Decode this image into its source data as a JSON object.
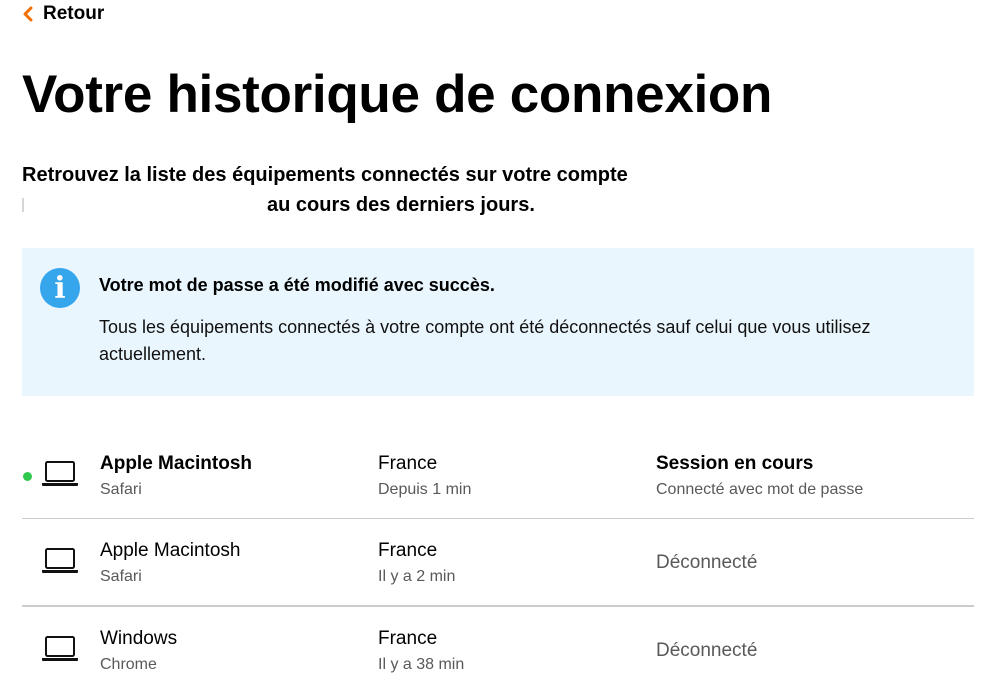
{
  "nav": {
    "back_label": "Retour"
  },
  "page": {
    "title": "Votre historique de connexion",
    "intro_line1": "Retrouvez la liste des équipements connectés sur votre compte",
    "intro_line2": "au cours des derniers jours."
  },
  "info": {
    "icon": "info-icon",
    "heading": "Votre mot de passe a été modifié avec succès.",
    "body": "Tous les équipements connectés à votre compte ont été déconnectés sauf celui que vous utilisez actuellement."
  },
  "colors": {
    "accent": "#f16e00",
    "info_bg": "#e9f6fd",
    "info_icon": "#35a5ec",
    "active_dot": "#32c850"
  },
  "sessions": [
    {
      "icon": "laptop-icon",
      "active": true,
      "device": "Apple Macintosh",
      "browser": "Safari",
      "country": "France",
      "time": "Depuis 1 min",
      "status": "Session en cours",
      "status_detail": "Connecté avec mot de passe"
    },
    {
      "icon": "laptop-icon",
      "active": false,
      "device": "Apple Macintosh",
      "browser": "Safari",
      "country": "France",
      "time": "Il y a 2 min",
      "status": "Déconnecté"
    },
    {
      "icon": "laptop-icon",
      "active": false,
      "device": "Windows",
      "browser": "Chrome",
      "country": "France",
      "time": "Il y a 38 min",
      "status": "Déconnecté"
    }
  ]
}
